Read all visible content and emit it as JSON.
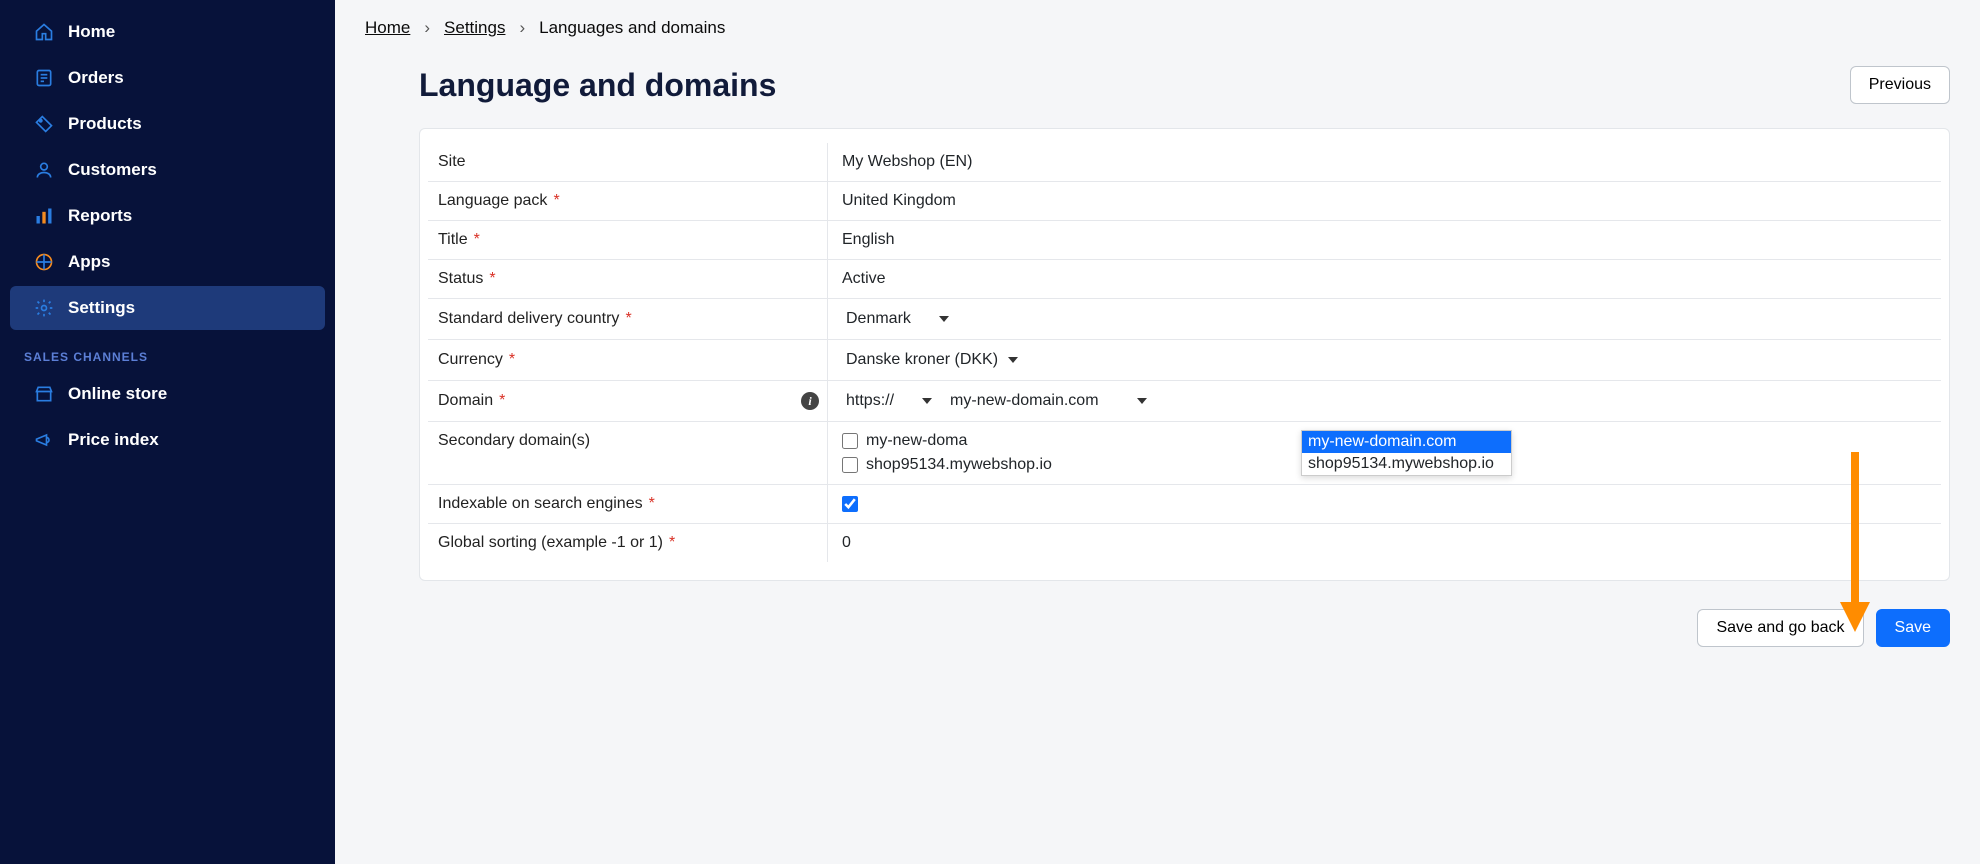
{
  "sidebar": {
    "items": [
      {
        "label": "Home"
      },
      {
        "label": "Orders"
      },
      {
        "label": "Products"
      },
      {
        "label": "Customers"
      },
      {
        "label": "Reports"
      },
      {
        "label": "Apps"
      },
      {
        "label": "Settings"
      }
    ],
    "section_label": "SALES CHANNELS",
    "channels": [
      {
        "label": "Online store"
      },
      {
        "label": "Price index"
      }
    ]
  },
  "breadcrumb": {
    "home": "Home",
    "settings": "Settings",
    "current": "Languages and domains"
  },
  "page": {
    "title": "Language and domains",
    "previous": "Previous"
  },
  "fields": {
    "site": {
      "label": "Site",
      "value": "My Webshop (EN)"
    },
    "language_pack": {
      "label": "Language pack",
      "value": "United Kingdom"
    },
    "title": {
      "label": "Title",
      "value": "English"
    },
    "status": {
      "label": "Status",
      "value": "Active"
    },
    "delivery_country": {
      "label": "Standard delivery country",
      "value": "Denmark"
    },
    "currency": {
      "label": "Currency",
      "value": "Danske kroner (DKK)"
    },
    "domain": {
      "label": "Domain",
      "protocol": "https://",
      "value": "my-new-domain.com"
    },
    "secondary": {
      "label": "Secondary domain(s)",
      "opt1": "my-new-doma",
      "opt2": "shop95134.mywebshop.io"
    },
    "indexable": {
      "label": "Indexable on search engines"
    },
    "sorting": {
      "label": "Global sorting (example -1 or 1)",
      "value": "0"
    }
  },
  "dropdown": {
    "opt1": "my-new-domain.com",
    "opt2": "shop95134.mywebshop.io"
  },
  "footer": {
    "save_back": "Save and go back",
    "save": "Save"
  }
}
